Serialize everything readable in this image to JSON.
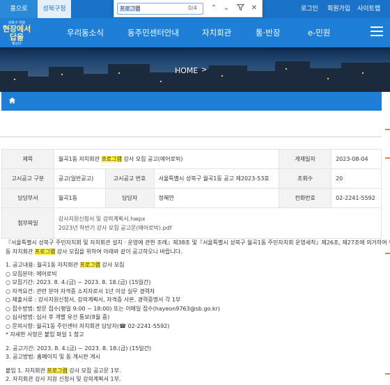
{
  "topbar": {
    "home_tab": "홈으로",
    "office_tab": "성북구청",
    "login": "로그인",
    "join": "회원가입",
    "sitemap": "사이트맵"
  },
  "findbar": {
    "query": "프로그램",
    "count": "0/4"
  },
  "logo": {
    "line1": "성북구 마을",
    "line2": "현장에서",
    "line3": "답을",
    "line4": "찾는다"
  },
  "nav": {
    "items": [
      "우리동소식",
      "동주민센터안내",
      "자치회관",
      "통·반장",
      "e-민원"
    ]
  },
  "hero": {
    "title": "HOME",
    "arrow": ">"
  },
  "table": {
    "title_label": "제목",
    "title_pre": "월곡1동 자치회관 ",
    "title_hl": "프로그램",
    "title_post": " 강사 모집 공고(에어로빅)",
    "date_label": "게재일자",
    "date_value": "2023-08-04",
    "type_label": "고시공고 구분",
    "type_value": "공고(일반공고)",
    "notice_no_label": "고시공고 번호",
    "notice_no_value": "서울특별시 성북구 월곡1동 공고 제2023-53호",
    "views_label": "조회수",
    "views_value": "20",
    "dept_label": "담당부서",
    "dept_value": "월곡1동",
    "person_label": "담당자",
    "person_value": "정혜연",
    "phone_label": "전화번호",
    "phone_value": "02-2241-5592",
    "attach_label": "첨부파일",
    "files": [
      "강사지원신청서 및 강의계획서.hwpx",
      "2023년 하반기 강사 모집 공고문(에어로빅).pdf"
    ]
  },
  "content": {
    "intro1": "『서울특별시 성북구 주민자치회 및 자치회관 설치 · 운영에 관한 조례』제38조 및『서울특별시 성북구 월곡1동 주민자치회 운영세칙』제26조, 제27조에 의거하여 우리",
    "intro2_pre": "동 자치회관 ",
    "intro2_hl": "프로그램",
    "intro2_post": " 강사 모집을 위하여 아래와 같이 공고하오니 바랍니다.",
    "s1_pre": "1. 공고내용: 월곡1동 자치회관 ",
    "s1_hl": "프로그램",
    "s1_post": " 강사 모집",
    "l1": "○ 모집분야: 에어로빅",
    "l2": "○ 모집기간: 2023. 8. 4.(금) ~ 2023. 8. 18.(금) (15일간)",
    "l3": "○ 자격요건: 관련 분야 자격증 소지자로서 1년 이상 실무 경력자",
    "l4": "○ 제출서류 : 강사지원신청서, 강의계획서, 자격증 사본, 경력증명서 각 1부",
    "l5": "○ 접수방법: 방문 접수(평일 9:00 ~ 18:00) 또는 이메일 접수(hayeon9763@sb.go.kr)",
    "l6": "○ 심사방법: 심사 후 개별 유선 통보(8월 중)",
    "l7": "○ 문의사항: 월곡1동 주민센터 자치회관 담당자(☎ 02-2241-5592)",
    "l8": "* 자세한 사항은 붙임 파일 1 참고",
    "s2": "2. 공고기간: 2023. 8. 4.(금) ~ 2023. 8. 18.(금) (15일간)",
    "s3": "3. 공고방법: 홈페이지 및 동 게시판 게시",
    "a1_pre": "붙임 1. 자치회관 ",
    "a1_hl": "프로그램",
    "a1_post": " 강사 모집 공고문 1부.",
    "a2": "2. 자치회관 강사 지원 신청서 및 강의계획서 1부."
  }
}
